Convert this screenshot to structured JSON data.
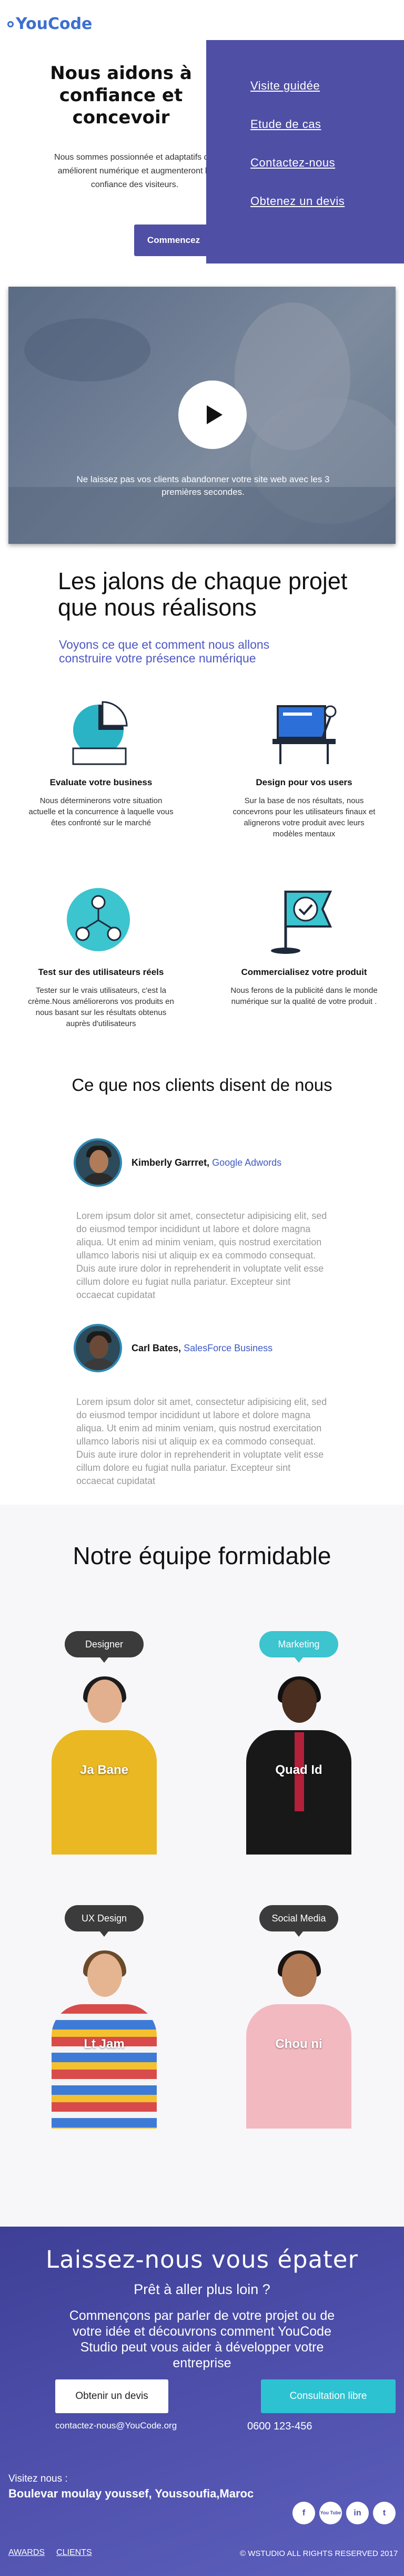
{
  "header": {
    "logo": "YouCode",
    "hero_title": "Nous aidons à confiance et concevoir",
    "hero_text": "Nous sommes possionnée et adaptatifs qui améliorent numérique et augmenteront la confiance des visiteurs.",
    "cta": "Commencez"
  },
  "menu": {
    "items": [
      "Visite guidée",
      "Etude de cas",
      "Contactez-nous",
      "Obtenez un devis"
    ]
  },
  "video": {
    "caption": "Ne laissez pas vos clients abandonner votre site web avec les 3 premières secondes.",
    "play_icon": "play-icon"
  },
  "milestones": {
    "title": "Les jalons de chaque projet que nous réalisons",
    "subtitle": "Voyons ce que et comment nous allons construire votre présence numérique",
    "items": [
      {
        "title": "Evaluate votre business",
        "text": "Nous déterminerons votre situation actuelle et la concurrence à laquelle vous êtes confronté sur le marché"
      },
      {
        "title": "Design pour vos users",
        "text": "Sur la base de nos  résultats, nous concevrons pour les utilisateurs finaux et alignerons votre produit avec leurs modèles mentaux"
      },
      {
        "title": "Test sur des utilisateurs réels",
        "text": "Tester sur le vrais utilisateurs, c'est la crème.Nous améliorerons vos produits en nous basant sur les résultats obtenus auprès d'utilisateurs"
      },
      {
        "title": "Commercialisez votre produit",
        "text": "Nous ferons de la publicité dans le monde numérique sur la qualité de votre produit ."
      }
    ]
  },
  "testimonials": {
    "title": "Ce que nos clients disent de nous",
    "items": [
      {
        "name": "Kimberly Garrret,",
        "company": "Google Adwords",
        "text": "Lorem ipsum dolor sit amet, consectetur adipisicing elit, sed do eiusmod tempor incididunt ut labore et dolore magna aliqua. Ut enim ad minim veniam, quis nostrud exercitation ullamco laboris nisi ut aliquip ex ea commodo consequat. Duis aute irure dolor in reprehenderit in voluptate velit esse cillum dolore eu fugiat nulla pariatur. Excepteur sint occaecat cupidatat"
      },
      {
        "name": "Carl Bates,",
        "company": "SalesForce Business",
        "text": "Lorem ipsum dolor sit amet, consectetur adipisicing elit, sed do eiusmod tempor incididunt ut labore et dolore magna aliqua. Ut enim ad minim veniam, quis nostrud exercitation ullamco laboris nisi ut aliquip ex ea commodo consequat. Duis aute irure dolor in reprehenderit in voluptate velit esse cillum dolore eu fugiat nulla pariatur. Excepteur sint occaecat cupidatat"
      }
    ]
  },
  "team": {
    "title": "Notre équipe formidable",
    "members": [
      {
        "role": "Designer",
        "name": "Ja Bane",
        "role_color": "#3b3b3b"
      },
      {
        "role": "Marketing",
        "name": "Quad Id",
        "role_color": "#3cc4cf"
      },
      {
        "role": "UX Design",
        "name": "Lt Jam",
        "role_color": "#3b3b3b"
      },
      {
        "role": "Social Media",
        "name": "Chou ni",
        "role_color": "#3b3b3b"
      }
    ]
  },
  "cta": {
    "title": "Laissez-nous vous épater",
    "subtitle": "Prêt à aller plus loin ?",
    "text": "Commençons par parler de votre projet ou de votre idée et découvrons comment YouCode Studio peut vous aider à développer votre entreprise",
    "btn_quote": "Obtenir un devis",
    "btn_consult": "Consultation libre",
    "email": "contactez-nous@YouCode.org",
    "phone": "0600 123-456"
  },
  "footer": {
    "visit_label": "Visitez nous :",
    "address": "Boulevar moulay youssef, Youssoufia,Maroc",
    "socials": [
      "f",
      "You Tube",
      "in",
      "t"
    ],
    "links": [
      "AWARDS",
      "CLIENTS"
    ],
    "copyright": "© WSTUDIO ALL RIGHTS RESERVED 2017"
  },
  "colors": {
    "brand": "#4f4fa6",
    "accent": "#2cc2d2",
    "link": "#3c5bc4"
  }
}
